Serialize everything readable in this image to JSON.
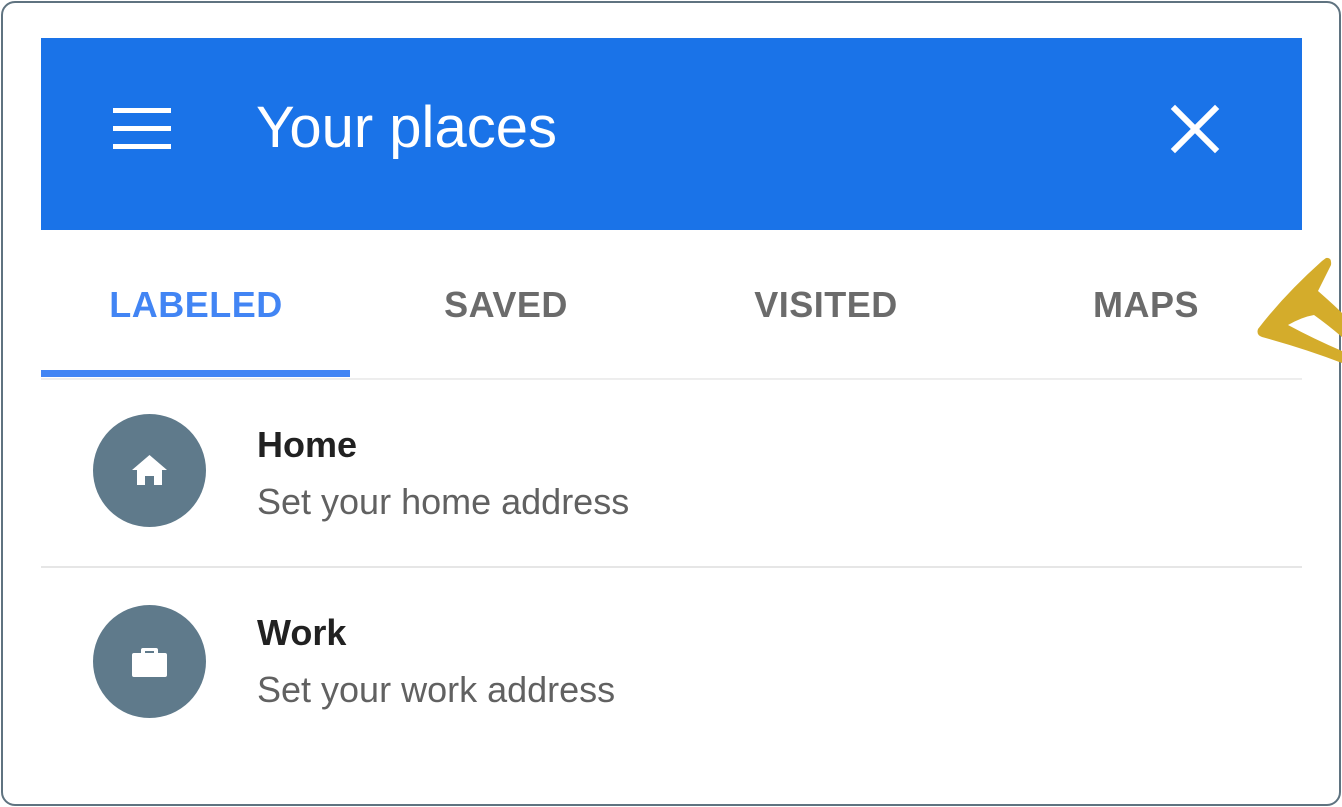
{
  "appbar": {
    "title": "Your places",
    "menu_icon": "hamburger-menu-icon",
    "close_icon": "close-icon",
    "color": "#1a73e8"
  },
  "tabs": [
    {
      "label": "LABELED",
      "active": true
    },
    {
      "label": "SAVED",
      "active": false
    },
    {
      "label": "VISITED",
      "active": false
    },
    {
      "label": "MAPS",
      "active": false
    }
  ],
  "accent_color": "#4285f4",
  "places": [
    {
      "label": "Home",
      "subtitle": "Set your home address",
      "icon": "home-icon"
    },
    {
      "label": "Work",
      "subtitle": "Set your work address",
      "icon": "briefcase-icon"
    }
  ],
  "annotation": {
    "icon": "arrow-pointer-icon",
    "color": "#d4ac2b"
  }
}
